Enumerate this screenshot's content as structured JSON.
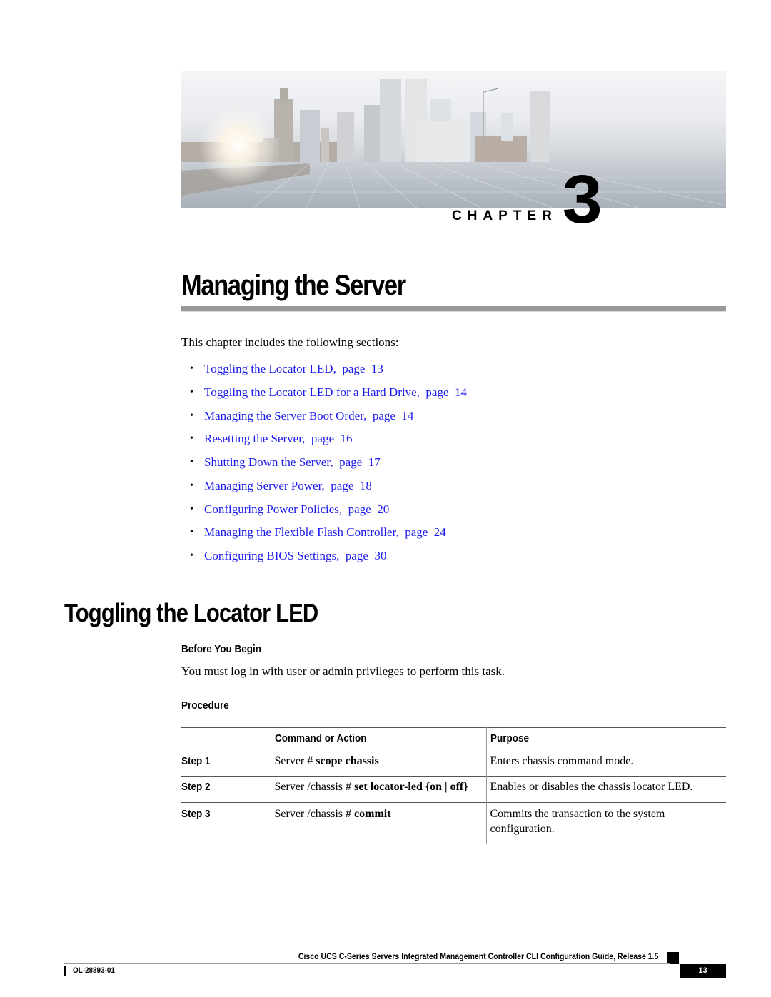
{
  "header": {
    "chapter_label": "CHAPTER",
    "chapter_number": "3",
    "hero_image": "city-skyline-rooftop-solar-panels"
  },
  "title": "Managing the Server",
  "intro": "This chapter includes the following sections:",
  "toc": [
    {
      "label": "Toggling the Locator LED,  page  13"
    },
    {
      "label": "Toggling the Locator LED for a Hard Drive,  page  14"
    },
    {
      "label": "Managing the Server Boot Order,  page  14"
    },
    {
      "label": "Resetting the Server,  page  16"
    },
    {
      "label": "Shutting Down the Server,  page  17"
    },
    {
      "label": "Managing Server Power,  page  18"
    },
    {
      "label": "Configuring Power Policies,  page  20"
    },
    {
      "label": "Managing the Flexible Flash Controller,  page  24"
    },
    {
      "label": "Configuring BIOS Settings,  page  30"
    }
  ],
  "section": {
    "title": "Toggling the Locator LED",
    "before_heading": "Before You Begin",
    "before_text": "You must log in with user or admin privileges to perform this task.",
    "procedure_heading": "Procedure",
    "table": {
      "headers": [
        "",
        "Command or Action",
        "Purpose"
      ],
      "rows": [
        {
          "step": "Step 1",
          "prompt": "Server # ",
          "command": "scope chassis",
          "purpose": "Enters chassis command mode."
        },
        {
          "step": "Step 2",
          "prompt": "Server /chassis # ",
          "command": "set locator-led {on | off}",
          "purpose": "Enables or disables the chassis locator LED."
        },
        {
          "step": "Step 3",
          "prompt": "Server /chassis # ",
          "command": "commit",
          "purpose": "Commits the transaction to the system configuration."
        }
      ]
    }
  },
  "footer": {
    "guide_title": "Cisco UCS C-Series Servers Integrated Management Controller CLI Configuration Guide, Release 1.5",
    "doc_number": "OL-28893-01",
    "page_number": "13"
  },
  "colors": {
    "link": "#1a1aee",
    "rule": "#999999",
    "text": "#000000"
  }
}
